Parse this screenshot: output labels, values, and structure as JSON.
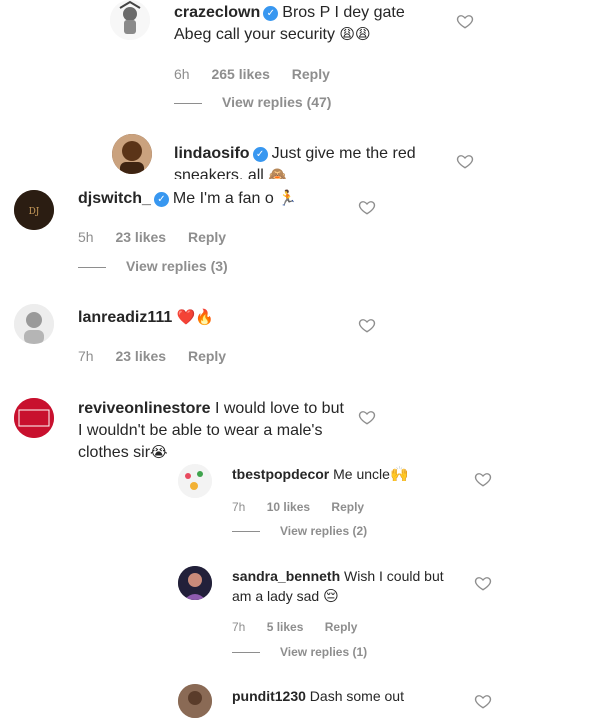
{
  "comments": [
    {
      "username": "crazeclown",
      "verified": true,
      "text": "Bros P I dey gate Abeg call your security",
      "emoji": "😩😩",
      "time": "6h",
      "likes": "265 likes",
      "reply": "Reply",
      "view_replies": "View replies (47)"
    },
    {
      "username": "lindaosifo",
      "verified": true,
      "text": "Just give me the red sneakers, all",
      "emoji": "🙈"
    },
    {
      "username": "djswitch_",
      "verified": true,
      "text": "Me I'm a fan o",
      "emoji": "🏃",
      "time": "5h",
      "likes": "23 likes",
      "reply": "Reply",
      "view_replies": "View replies (3)"
    },
    {
      "username": "lanreadiz111",
      "verified": false,
      "text": "",
      "emoji": "❤️🔥",
      "time": "7h",
      "likes": "23 likes",
      "reply": "Reply"
    },
    {
      "username": "reviveonlinestore",
      "verified": false,
      "text": "I would love to but I wouldn't be able to wear a male's clothes sir",
      "emoji": "😭",
      "avatar_text": "REVIVE ONLINE STORES"
    },
    {
      "username": "tbestpopdecor",
      "verified": false,
      "text": "Me uncle",
      "emoji": "🙌",
      "time": "7h",
      "likes": "10 likes",
      "reply": "Reply",
      "view_replies": "View replies (2)"
    },
    {
      "username": "sandra_benneth",
      "verified": false,
      "text": "Wish I could but am a lady sad",
      "emoji": "😔",
      "time": "7h",
      "likes": "5 likes",
      "reply": "Reply",
      "view_replies": "View replies (1)"
    },
    {
      "username": "pundit1230",
      "verified": false,
      "text": "Dash some out"
    }
  ],
  "colors": {
    "text": "#262626",
    "muted": "#8e8e8e",
    "verified": "#3897f0"
  }
}
